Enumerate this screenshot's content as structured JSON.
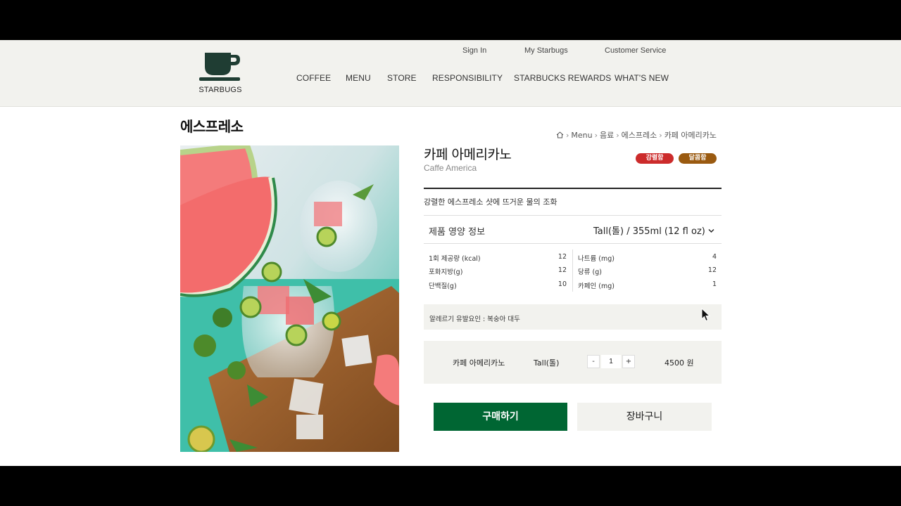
{
  "brand": {
    "name": "STARBUGS",
    "accent": "#006633",
    "logo_icon": "coffee-cup-icon"
  },
  "header": {
    "util_links": [
      "Sign In",
      "My Starbugs",
      "Customer Service"
    ],
    "nav": [
      "COFFEE",
      "MENU",
      "STORE",
      "RESPONSIBILITY",
      "STARBUCKS REWARDS",
      "WHAT'S NEW"
    ]
  },
  "page": {
    "title": "에스프레소"
  },
  "breadcrumb": {
    "home_icon": "home-icon",
    "items": [
      "Menu",
      "음료",
      "에스프레소",
      "카페 아메리카노"
    ]
  },
  "product": {
    "name": "카페 아메리카노",
    "name_en": "Caffe America",
    "tags": [
      {
        "label": "강렬함",
        "color": "#cc2b2b"
      },
      {
        "label": "달콤함",
        "color": "#9a5a10"
      }
    ],
    "description": "강렬한 에스프레소 샷에 뜨거운 물의 조화",
    "image_alt_icon": "iced-drink-watermelon-photo"
  },
  "nutrition": {
    "title": "제품 영양 정보",
    "size_select": "Tall(톨) / 355ml (12 fl oz)",
    "left": [
      {
        "label": "1회 제공량 (kcal)",
        "value": "12"
      },
      {
        "label": "포화지방(g)",
        "value": "12"
      },
      {
        "label": "단백질(g)",
        "value": "10"
      }
    ],
    "right": [
      {
        "label": "나트륨 (mg)",
        "value": "4"
      },
      {
        "label": "당류 (g)",
        "value": "12"
      },
      {
        "label": "카페인 (mg)",
        "value": "1"
      }
    ],
    "allergy": "알레르기 유발요인 : 복숭아 대두"
  },
  "order": {
    "name": "카페 아메리카노",
    "size": "Tall(톨)",
    "minus": "-",
    "qty": "1",
    "plus": "+",
    "price": "4500 원"
  },
  "buttons": {
    "buy": "구매하기",
    "cart": "장바구니"
  }
}
